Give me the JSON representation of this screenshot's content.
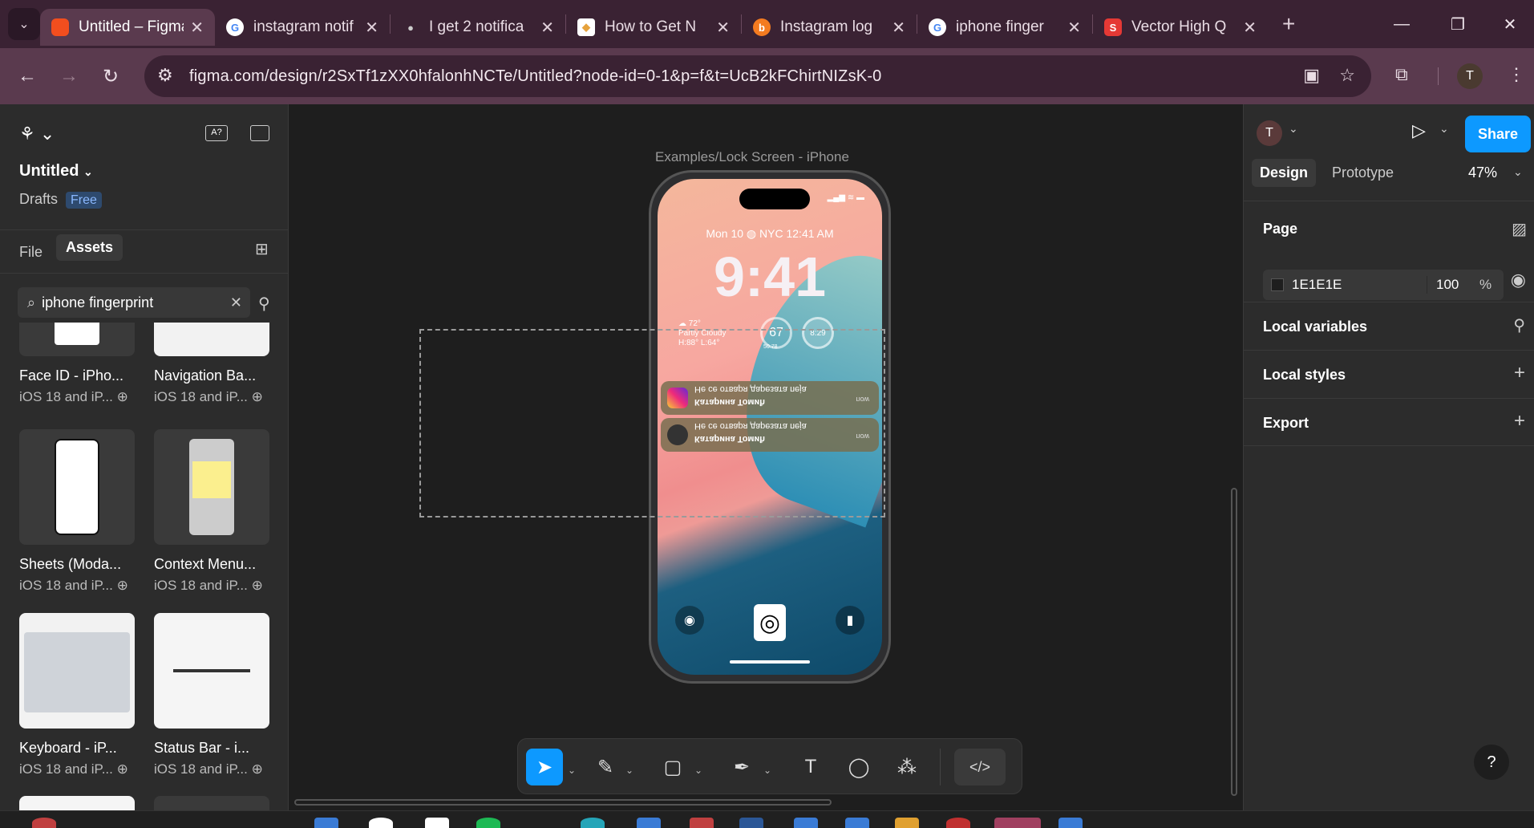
{
  "browser": {
    "tabs": [
      {
        "title": "Untitled – Figma",
        "icon": "figma-icon",
        "active": true
      },
      {
        "title": "instagram notif",
        "icon": "google-icon"
      },
      {
        "title": "I get 2 notifica",
        "icon": "apple-icon"
      },
      {
        "title": "How to Get N",
        "icon": "site-icon"
      },
      {
        "title": "Instagram log",
        "icon": "brave-icon"
      },
      {
        "title": "iphone finger",
        "icon": "google-icon"
      },
      {
        "title": "Vector High Q",
        "icon": "vector-icon"
      }
    ],
    "url": "figma.com/design/r2SxTf1zXX0hfalonhNCTe/Untitled?node-id=0-1&p=f&t=UcB2kFChirtNIZsK-0",
    "profile_initial": "T"
  },
  "left_panel": {
    "file_name": "Untitled",
    "location": "Drafts",
    "plan_badge": "Free",
    "tab_file": "File",
    "tab_assets": "Assets",
    "search_value": "iphone fingerprint",
    "assets": [
      {
        "name": "Face ID - iPho...",
        "library": "iOS 18 and iP..."
      },
      {
        "name": "Navigation Ba...",
        "library": "iOS 18 and iP..."
      },
      {
        "name": "Sheets (Moda...",
        "library": "iOS 18 and iP..."
      },
      {
        "name": "Context Menu...",
        "library": "iOS 18 and iP..."
      },
      {
        "name": "Keyboard - iP...",
        "library": "iOS 18 and iP..."
      },
      {
        "name": "Status Bar - i...",
        "library": "iOS 18 and iP..."
      }
    ]
  },
  "canvas": {
    "frame_label": "Examples/Lock Screen - iPhone",
    "lock_screen": {
      "date_line": "Mon 10 ◍ NYC 12:41 AM",
      "time": "9:41",
      "weather": [
        "☁ 72°",
        "Partly Cloudy",
        "H:88° L:64°"
      ],
      "gauge_value": "67",
      "gauge_sub": "50  78",
      "clock_widget": "8:29",
      "notifications": [
        {
          "line1": "Не се отваря дарезата пеја",
          "line2": "Катарина Томић",
          "time": "now"
        },
        {
          "line1": "Не се отваря дарезата пеја",
          "line2": "Катарина Томић",
          "time": "now"
        }
      ]
    }
  },
  "right_panel": {
    "user_initial": "T",
    "share_label": "Share",
    "tab_design": "Design",
    "tab_prototype": "Prototype",
    "zoom": "47%",
    "page_section": "Page",
    "page_color": "1E1E1E",
    "page_opacity": "100",
    "opacity_unit": "%",
    "local_variables": "Local variables",
    "local_styles": "Local styles",
    "export": "Export",
    "help": "?"
  },
  "colors": {
    "accent": "#0d99ff",
    "browser_frame": "#3a2233"
  }
}
